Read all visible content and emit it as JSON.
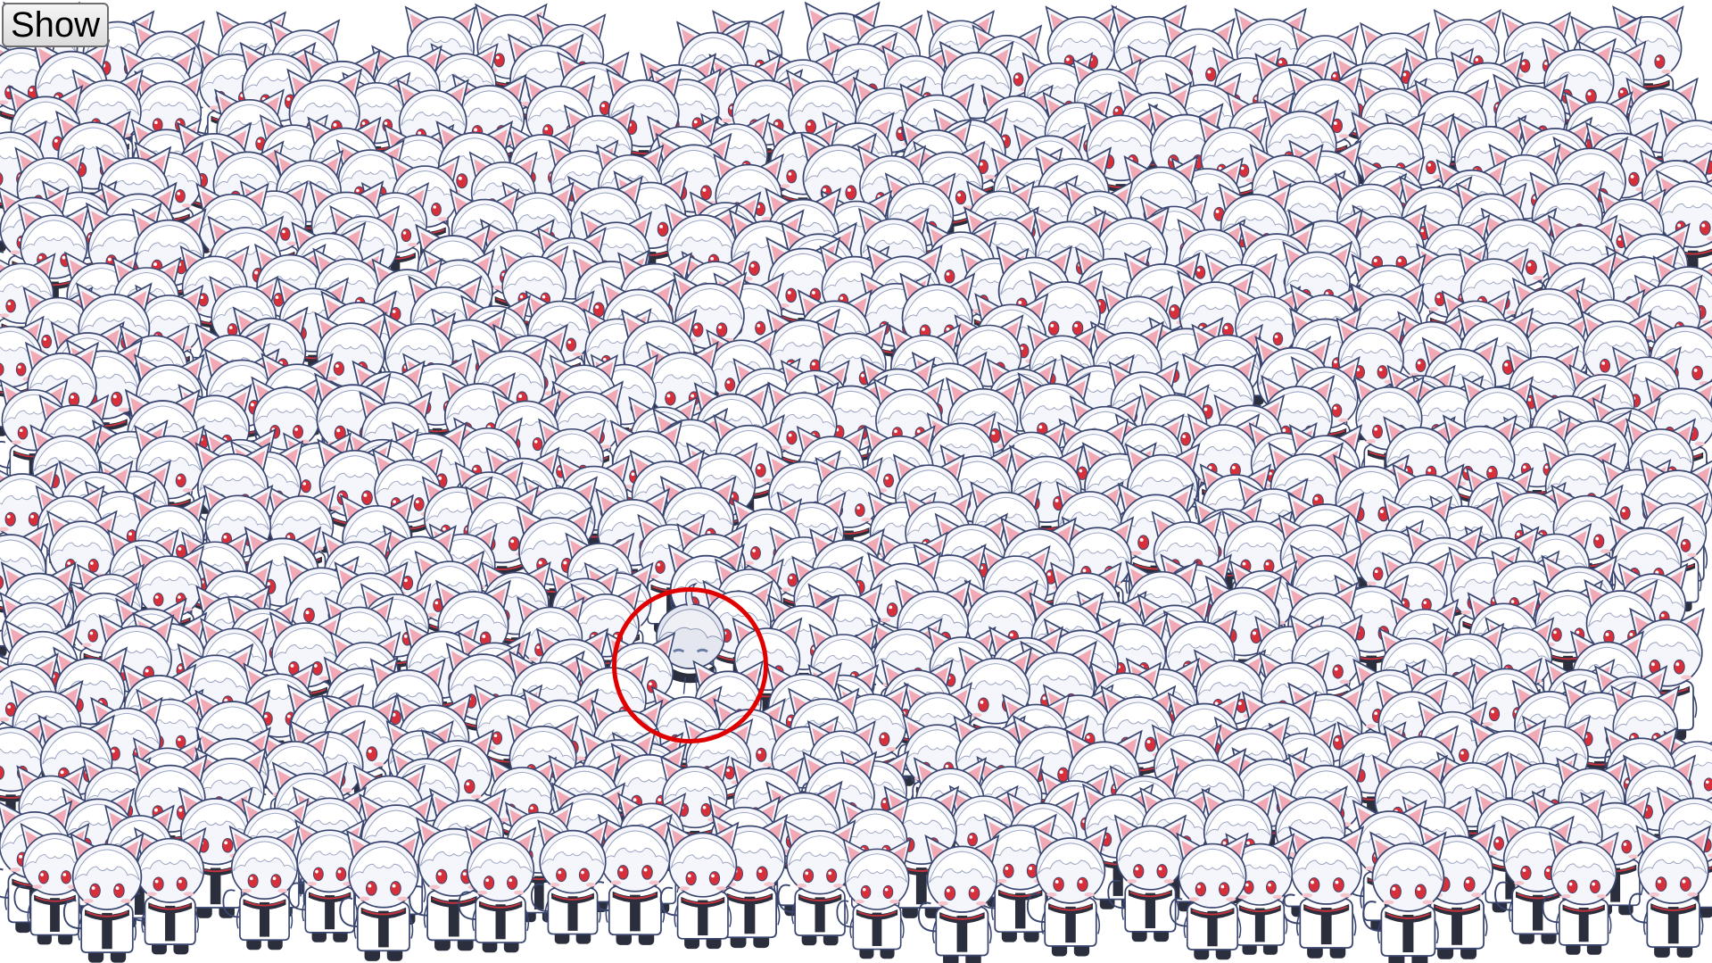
{
  "show_button": {
    "label": "Show"
  },
  "puzzle": {
    "type": "find-the-odd-one-out",
    "decoy_character": "white-haired-cat-ear-chibi",
    "target_character": "grey-haired-chibi-with-ahoge",
    "target_highlighted": true
  },
  "colors": {
    "background": "#ffffff",
    "hair": "#f4f6fb",
    "outline": "#3a4670",
    "ear_inner": "#f2a9b6",
    "eyes": "#d8303a",
    "collar_stripe": "#c8323c",
    "clothing_dark": "#2b2f3d",
    "target_hair": "#e4e7ef",
    "target_eyes": "#6a7aa0",
    "highlight": "#e00000"
  },
  "icons": {
    "decoy": "cat-girl-chibi-icon",
    "target": "odd-character-icon"
  }
}
